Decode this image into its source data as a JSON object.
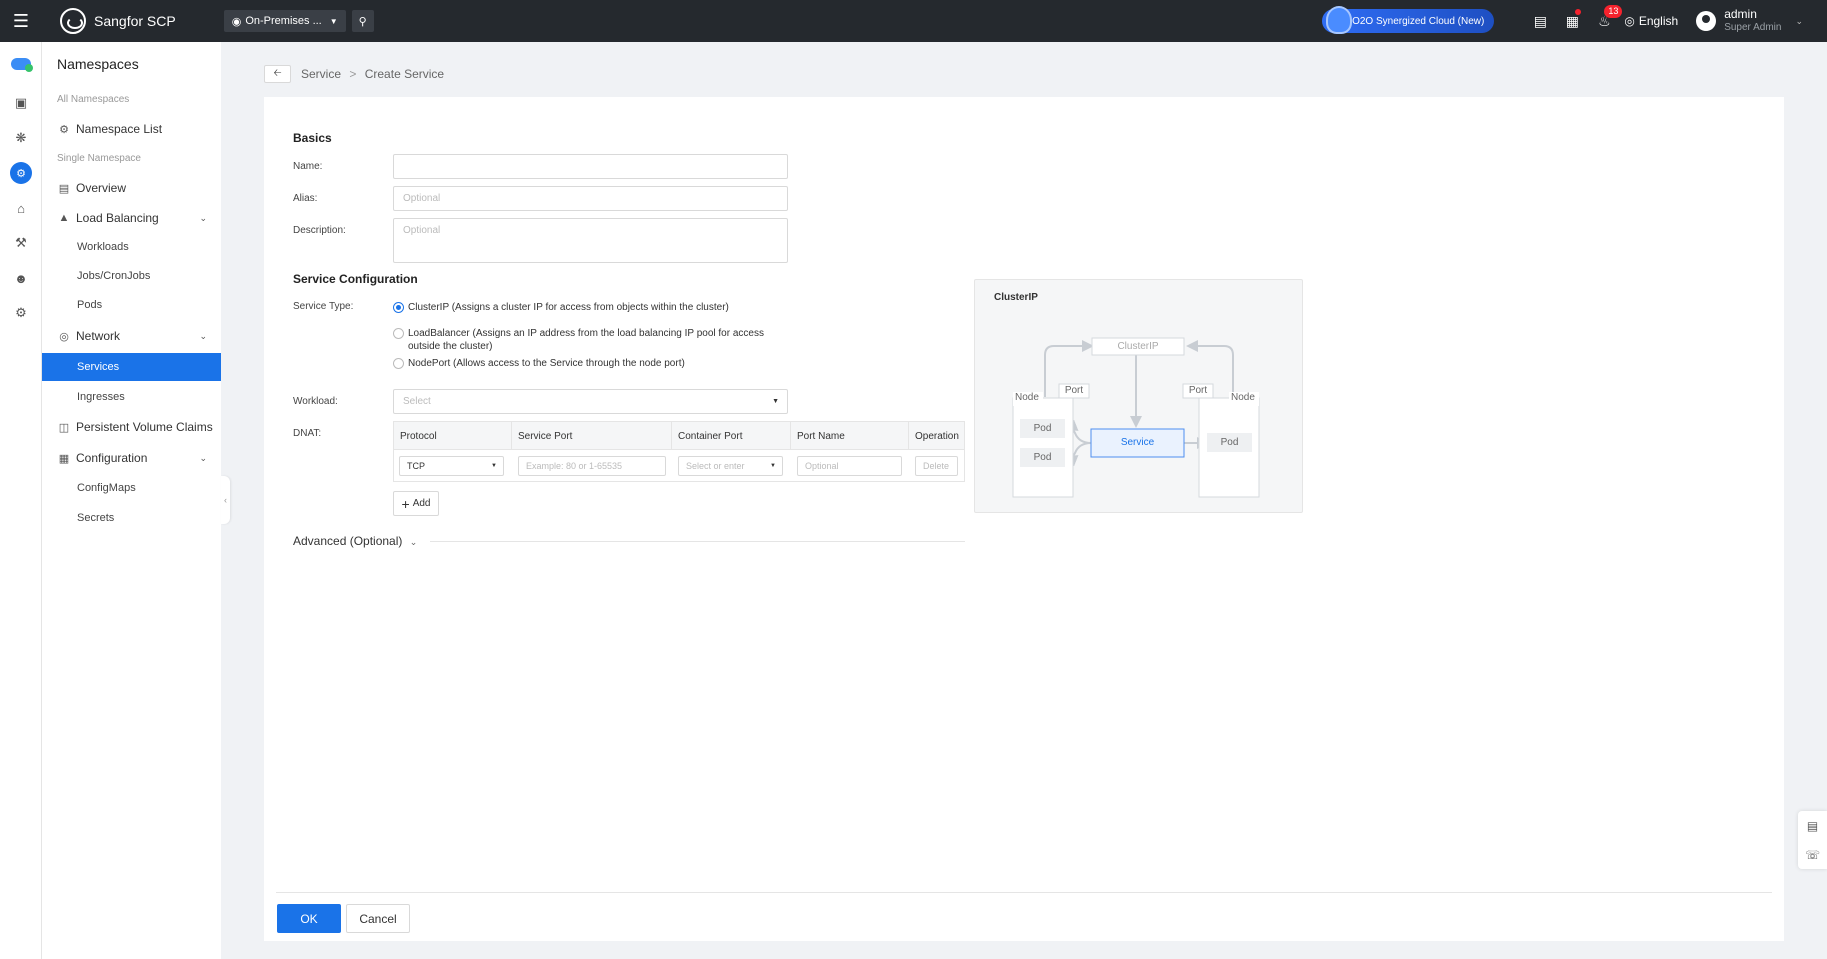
{
  "topbar": {
    "brand": "Sangfor SCP",
    "site_select": "On-Premises ...",
    "o2o_label": "O2O Synergized Cloud (New)",
    "alert_count": "13",
    "language": "English",
    "user_name": "admin",
    "user_role": "Super Admin"
  },
  "sidenav": {
    "title": "Namespaces",
    "group_all": "All Namespaces",
    "namespace_list": "Namespace List",
    "group_single": "Single Namespace",
    "overview": "Overview",
    "load_balancing": "Load Balancing",
    "workloads": "Workloads",
    "jobs": "Jobs/CronJobs",
    "pods": "Pods",
    "network": "Network",
    "services": "Services",
    "ingresses": "Ingresses",
    "pvc": "Persistent Volume Claims",
    "configuration": "Configuration",
    "configmaps": "ConfigMaps",
    "secrets": "Secrets"
  },
  "breadcrumb": {
    "parent": "Service",
    "separator": ">",
    "current": "Create Service"
  },
  "form": {
    "basics_title": "Basics",
    "name_label": "Name:",
    "name_value": "",
    "alias_label": "Alias:",
    "alias_placeholder": "Optional",
    "description_label": "Description:",
    "description_placeholder": "Optional",
    "service_config_title": "Service Configuration",
    "service_type_label": "Service Type:",
    "service_types": [
      {
        "label": "ClusterIP (Assigns a cluster IP for access from objects within the cluster)",
        "selected": true
      },
      {
        "label": "LoadBalancer (Assigns an IP address from the load balancing IP pool for access outside the cluster)",
        "selected": false
      },
      {
        "label": "NodePort (Allows access to the Service through the node port)",
        "selected": false
      }
    ],
    "workload_label": "Workload:",
    "workload_placeholder": "Select",
    "dnat_label": "DNAT:",
    "dnat_columns": [
      "Protocol",
      "Service Port",
      "Container Port",
      "Port Name",
      "Operation"
    ],
    "dnat_row": {
      "protocol": "TCP",
      "service_port_placeholder": "Example: 80 or 1-65535",
      "container_port_placeholder": "Select or enter",
      "port_name_placeholder": "Optional",
      "delete_label": "Delete"
    },
    "add_label": "Add",
    "advanced_label": "Advanced (Optional)"
  },
  "diagram": {
    "title": "ClusterIP",
    "cluster_ip": "ClusterIP",
    "node_label": "Node",
    "port_label": "Port",
    "pod_label": "Pod",
    "service_label": "Service"
  },
  "footer": {
    "ok_label": "OK",
    "cancel_label": "Cancel"
  },
  "colors": {
    "accent": "#1a73e8",
    "topbar": "#25292e",
    "badge": "#f5222d"
  }
}
